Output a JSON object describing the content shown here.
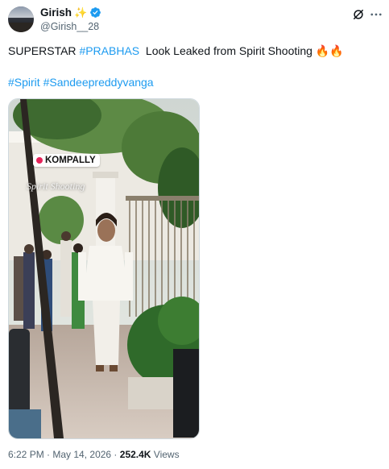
{
  "author": {
    "name": "Girish",
    "handle": "@Girish__28",
    "badge_icon": "sparkle-icon",
    "verified_icon": "verified-badge-icon",
    "verified_color": "#1d9bf0"
  },
  "actions": {
    "grok_icon": "grok-icon",
    "more_icon": "more-icon"
  },
  "tweet": {
    "text_prefix": "SUPERSTAR ",
    "hashtag_main": "#PRABHAS",
    "text_body": "  Look Leaked from Spirit Shooting ",
    "emoji": "🔥🔥",
    "hashtags": [
      "#Spirit",
      "#Sandeepreddyvanga"
    ]
  },
  "media": {
    "location_label": "KOMPALLY",
    "overlay_caption": "Spirit Shooting"
  },
  "meta": {
    "time": "6:22 PM",
    "separator": " · ",
    "date": "May 14, 2026",
    "views_count": "252.4K",
    "views_label": " Views"
  },
  "colors": {
    "link": "#1d9bf0",
    "secondary_text": "#536471",
    "primary_text": "#0f1419"
  }
}
